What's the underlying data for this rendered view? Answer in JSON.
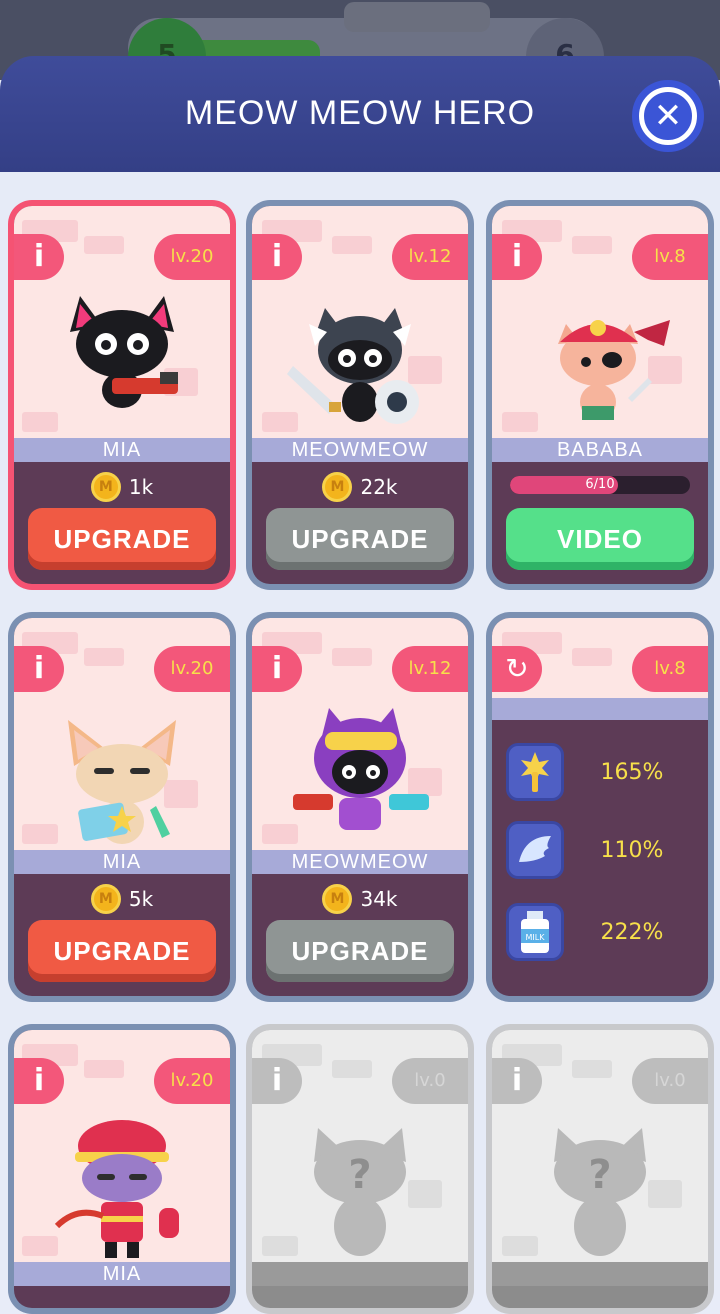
{
  "background": {
    "level_left": "5",
    "level_right": "6"
  },
  "header": {
    "title": "MEOW MEOW HERO"
  },
  "cards": [
    {
      "name": "MIA",
      "level": "lv.20",
      "price": "1k",
      "action": "UPGRADE"
    },
    {
      "name": "MEOWMEOW",
      "level": "lv.12",
      "price": "22k",
      "action": "UPGRADE"
    },
    {
      "name": "BABABA",
      "level": "lv.8",
      "progress_text": "6/10",
      "progress": 0.6,
      "action": "VIDEO"
    },
    {
      "name": "MIA",
      "level": "lv.20",
      "price": "5k",
      "action": "UPGRADE"
    },
    {
      "name": "MEOWMEOW",
      "level": "lv.12",
      "price": "34k",
      "action": "UPGRADE"
    },
    {
      "name": "MIA",
      "level": "lv.20"
    },
    {
      "level": "lv.0"
    },
    {
      "level": "lv.0"
    }
  ],
  "stats_card": {
    "level": "lv.8",
    "stats": [
      {
        "icon": "staff-icon",
        "value": "165%"
      },
      {
        "icon": "wing-icon",
        "value": "110%"
      },
      {
        "icon": "milk-icon",
        "value": "222%"
      }
    ]
  },
  "coin_letter": "M",
  "milk_label": "MILK",
  "locked_symbol": "?",
  "colors": {
    "header": "#3f4c9a",
    "selected_border": "#f55373",
    "upgrade_red": "#f05a44",
    "upgrade_gray": "#8f9594",
    "video_green": "#55e08a",
    "level_text": "#f7e04a"
  }
}
